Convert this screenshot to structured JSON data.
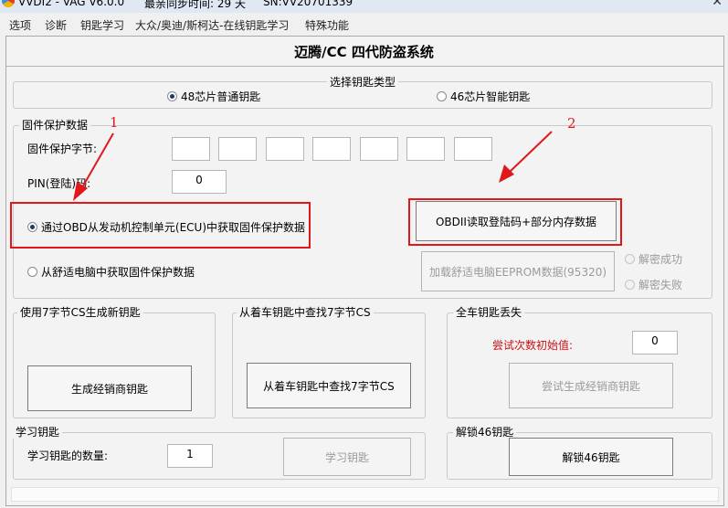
{
  "window": {
    "title_left": "VVDI2 - VAG V6.0.0",
    "sync_time": "最亲同步时间: 29 天",
    "serial": "SN:VV20701339",
    "close_glyph": "✕"
  },
  "menu": [
    "选项",
    "诊断",
    "钥匙学习",
    "大众/奥迪/斯柯达-在线钥匙学习",
    "特殊功能"
  ],
  "heading": "迈腾/CC 四代防盗系统",
  "key_type": {
    "legend": "选择钥匙类型",
    "options": [
      "48芯片普通钥匙",
      "46芯片智能钥匙"
    ],
    "selected_index": 0
  },
  "firmware": {
    "legend": "固件保护数据",
    "bytes_label": "固件保护字节:",
    "bytes": [
      "",
      "",
      "",
      "",
      "",
      "",
      ""
    ],
    "pin_label": "PIN(登陆)码:",
    "pin_value": "0",
    "option_obd": "通过OBD从发动机控制单元(ECU)中获取固件保护数据",
    "option_comfort": "从舒适电脑中获取固件保护数据",
    "btn_obd_read": "OBDII读取登陆码+部分内存数据",
    "btn_load_eeprom": "加载舒适电脑EEPROM数据(95320)",
    "decrypt_ok": "解密成功",
    "decrypt_fail": "解密失败"
  },
  "gen_cs": {
    "legend": "使用7字节CS生成新钥匙",
    "btn": "生成经销商钥匙"
  },
  "find_cs": {
    "legend": "从着车钥匙中查找7字节CS",
    "btn": "从着车钥匙中查找7字节CS"
  },
  "all_lost": {
    "legend": "全车钥匙丢失",
    "tries_label": "尝试次数初始值:",
    "tries_value": "0",
    "btn": "尝试生成经销商钥匙",
    "label_color": "#d01010"
  },
  "learn": {
    "legend": "学习钥匙",
    "count_label": "学习钥匙的数量:",
    "count_value": "1",
    "btn": "学习钥匙"
  },
  "unlock46": {
    "legend": "解锁46钥匙",
    "btn": "解锁46钥匙"
  },
  "annotations": {
    "label_1": "1",
    "label_2": "2",
    "color": "#e0181b"
  }
}
